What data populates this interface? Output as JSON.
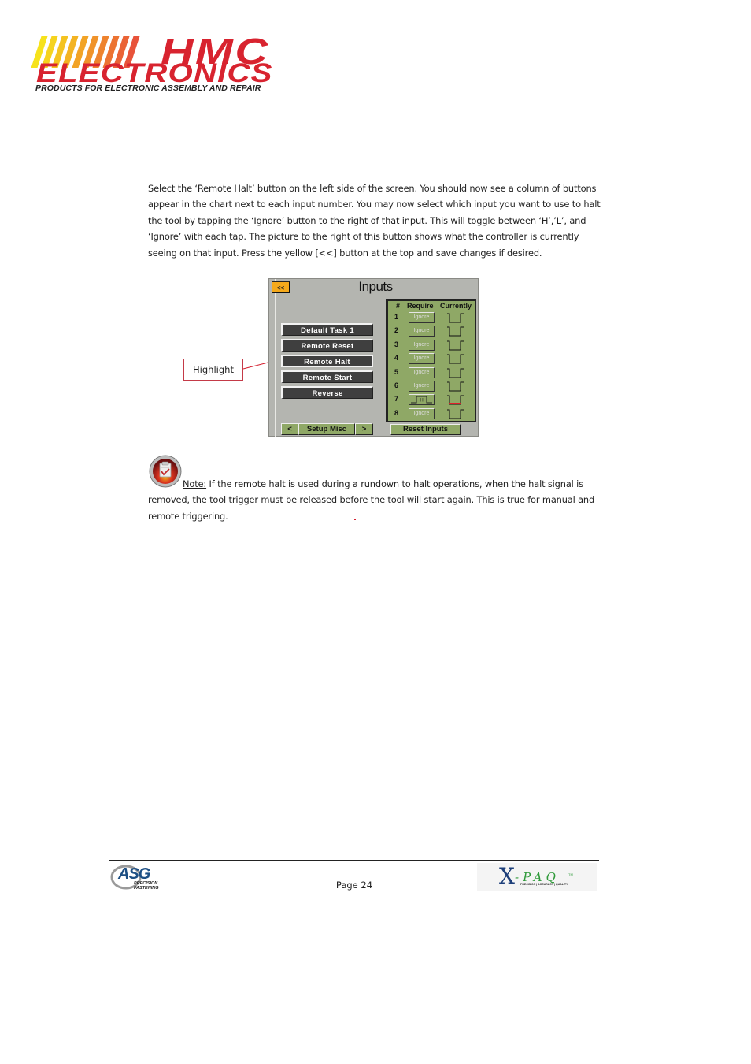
{
  "header": {
    "logo": {
      "brand": "HMC",
      "name": "ELECTRONICS",
      "tagline": "PRODUCTS FOR ELECTRONIC ASSEMBLY AND REPAIR",
      "colors": {
        "red": "#d8232f",
        "stripe_start": "#f7e41c",
        "stripe_end": "#e8503a"
      }
    }
  },
  "body": {
    "paragraph1": "Select the ‘Remote Halt’ button on the left side of the screen.  You should now see a column of buttons appear in the chart next to each input number.  You may now select which input you want to use to halt the tool by tapping the ‘Ignore’ button to the right of that input.  This will toggle between ‘H’,’L’, and ‘Ignore’ with each tap.  The picture to the right of this button shows what the controller is currently seeing on that input.  Press the yellow [<<] button at the top and save changes if desired.",
    "note_label": "Note:",
    "note_text": " If the remote halt is used during a rundown to halt operations, when the halt signal is removed, the tool trigger must be released before the tool will start again.  This is true for manual and remote triggering."
  },
  "callout": {
    "label": "Highlight",
    "color": "#d42030"
  },
  "screen": {
    "back_label": "<<",
    "title": "Inputs",
    "left_buttons": [
      {
        "label": "Default Task 1",
        "selected": false
      },
      {
        "label": "Remote Reset",
        "selected": false
      },
      {
        "label": "Remote Halt",
        "selected": true
      },
      {
        "label": "Remote Start",
        "selected": false
      },
      {
        "label": "Reverse",
        "selected": false
      }
    ],
    "nav": {
      "prev": "<",
      "label": "Setup Misc",
      "next": ">"
    },
    "table": {
      "headers": {
        "num": "#",
        "require": "Require",
        "currently": "Currently"
      },
      "rows": [
        {
          "num": "1",
          "require": "Ignore",
          "active": false,
          "current_state": "low"
        },
        {
          "num": "2",
          "require": "Ignore",
          "active": false,
          "current_state": "low"
        },
        {
          "num": "3",
          "require": "Ignore",
          "active": false,
          "current_state": "low"
        },
        {
          "num": "4",
          "require": "Ignore",
          "active": false,
          "current_state": "low"
        },
        {
          "num": "5",
          "require": "Ignore",
          "active": false,
          "current_state": "low"
        },
        {
          "num": "6",
          "require": "Ignore",
          "active": false,
          "current_state": "low"
        },
        {
          "num": "7",
          "require": "H",
          "active": true,
          "current_state": "low-flagged"
        },
        {
          "num": "8",
          "require": "Ignore",
          "active": false,
          "current_state": "low"
        }
      ]
    },
    "reset_label": "Reset Inputs",
    "colors": {
      "panel": "#b4b5b0",
      "table": "#8fa866",
      "button": "#3f3f3f",
      "back": "#f5a91b",
      "flag": "#e0202a"
    }
  },
  "footer": {
    "page_label": "Page 24",
    "left_logo": {
      "name": "ASG",
      "sub1": "PRECISION",
      "sub2": "FASTENING"
    },
    "right_logo": {
      "name": "X-PAQ",
      "tm": "TM",
      "tagline": "PRECISION | ACCURACY | QUALITY"
    }
  }
}
